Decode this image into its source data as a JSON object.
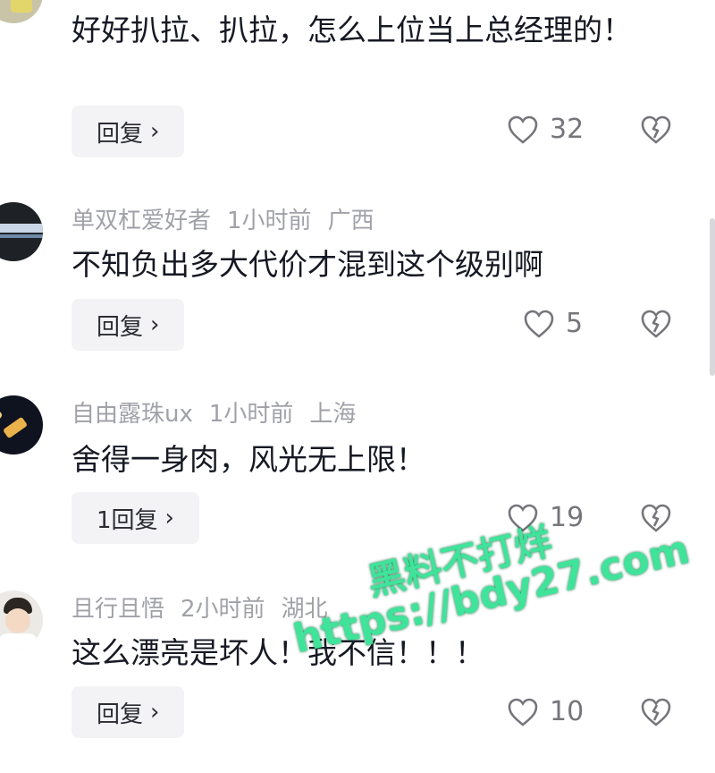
{
  "comments": [
    {
      "user": "",
      "time": "",
      "location": "",
      "text": "好好扒拉、扒拉，怎么上位当上总经理的！",
      "reply_label": "回复",
      "likes": "32"
    },
    {
      "user": "单双杠爱好者",
      "time": "1小时前",
      "location": "广西",
      "text": "不知负出多大代价才混到这个级别啊",
      "reply_label": "回复",
      "likes": "5"
    },
    {
      "user": "自由露珠ux",
      "time": "1小时前",
      "location": "上海",
      "text": "舍得一身肉，风光无上限！",
      "reply_label": "1回复",
      "likes": "19"
    },
    {
      "user": "且行且悟",
      "time": "2小时前",
      "location": "湖北",
      "text": "这么漂亮是坏人！我不信！！！",
      "reply_label": "回复",
      "likes": "10"
    }
  ],
  "icons": {
    "like": "heart-outline-icon",
    "dislike": "broken-heart-icon",
    "reply_chevron": "chevron-right-icon"
  },
  "watermark": {
    "line1": "黑料不打烊",
    "line2": "https://bdy27.com",
    "color": "#3fe39a"
  }
}
